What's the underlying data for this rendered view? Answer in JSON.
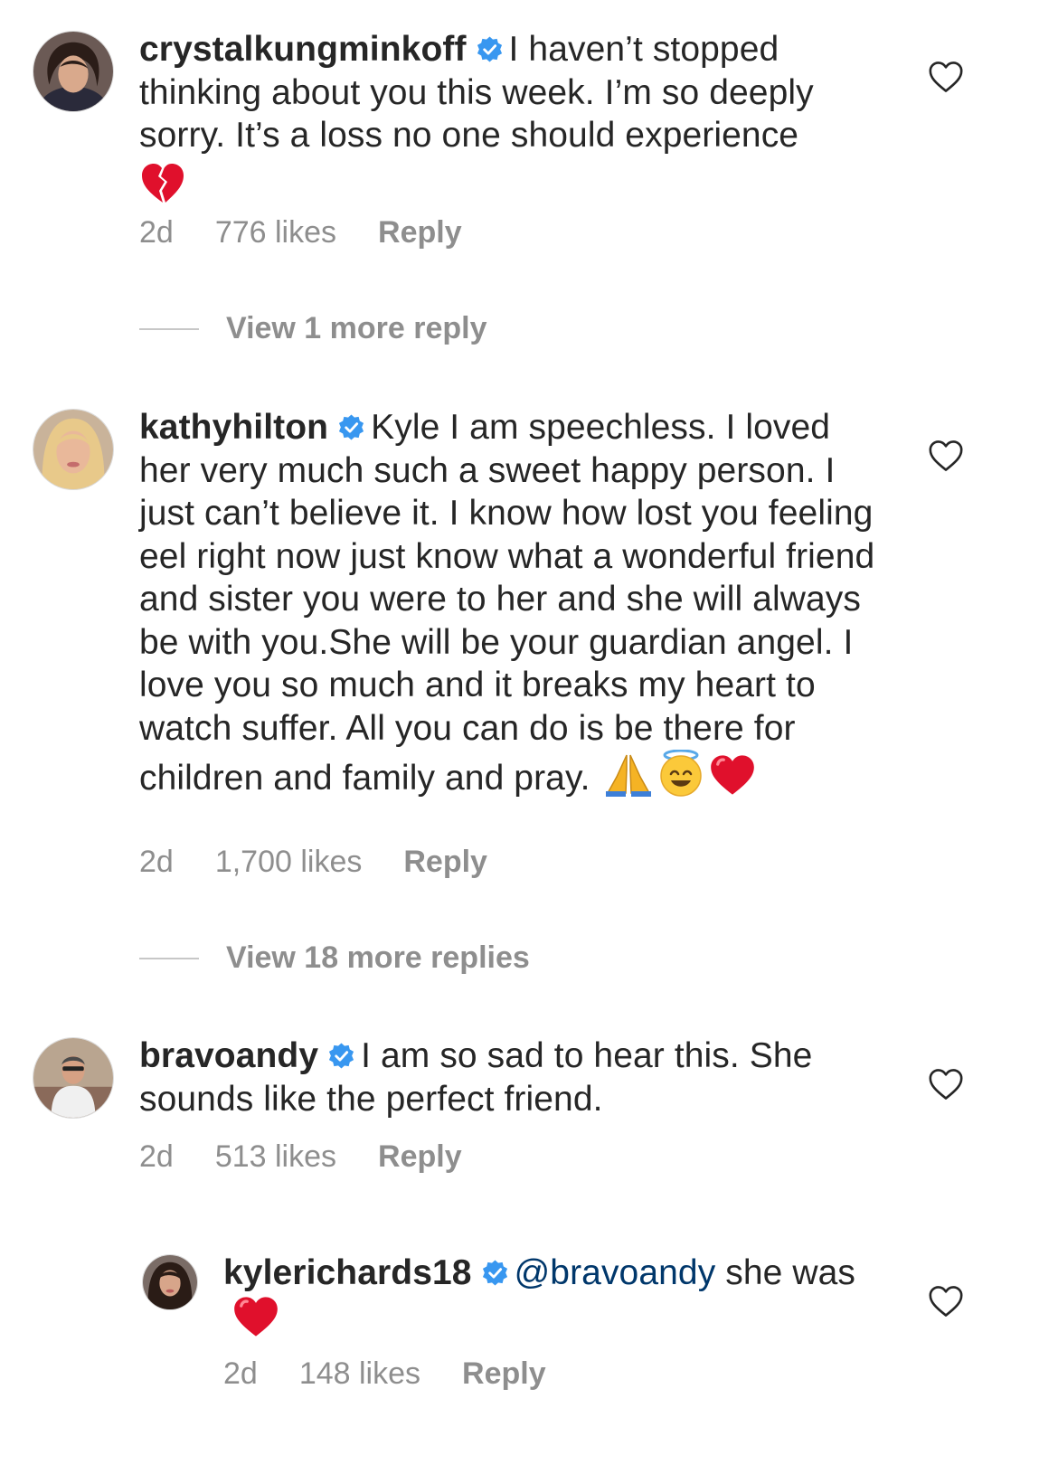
{
  "comments": [
    {
      "username": "crystalkungminkoff",
      "text": "I haven’t stopped thinking about you this week. I’m so deeply sorry. It’s a loss no one should experience",
      "emojis": [
        "broken-heart"
      ],
      "time": "2d",
      "likes": "776 likes",
      "reply": "Reply",
      "view_more": "View 1 more reply"
    },
    {
      "username": "kathyhilton",
      "text": "Kyle I am speechless. I loved her very much such a sweet happy person. I just can’t believe it. I know how lost you feeling eel right now just know what a wonderful friend and sister you were to her and she will always be with you.She will be your guardian angel. I love you so much and it breaks my heart to watch suffer. All you can do is be there for children and family and pray.",
      "emojis": [
        "folded-hands",
        "smiling-face-with-halo",
        "red-heart"
      ],
      "time": "2d",
      "likes": "1,700 likes",
      "reply": "Reply",
      "view_more": "View 18 more replies"
    },
    {
      "username": "bravoandy",
      "text": "I am so sad to hear this. She sounds like the perfect friend.",
      "time": "2d",
      "likes": "513 likes",
      "reply": "Reply"
    },
    {
      "username": "kylerichards18",
      "mention": "@bravoandy",
      "text": "she was",
      "emojis": [
        "red-heart"
      ],
      "time": "2d",
      "likes": "148 likes",
      "reply": "Reply"
    }
  ],
  "colors": {
    "text": "#262626",
    "meta": "#8e8e8e",
    "verified": "#3897f0",
    "mention": "#00376b"
  }
}
